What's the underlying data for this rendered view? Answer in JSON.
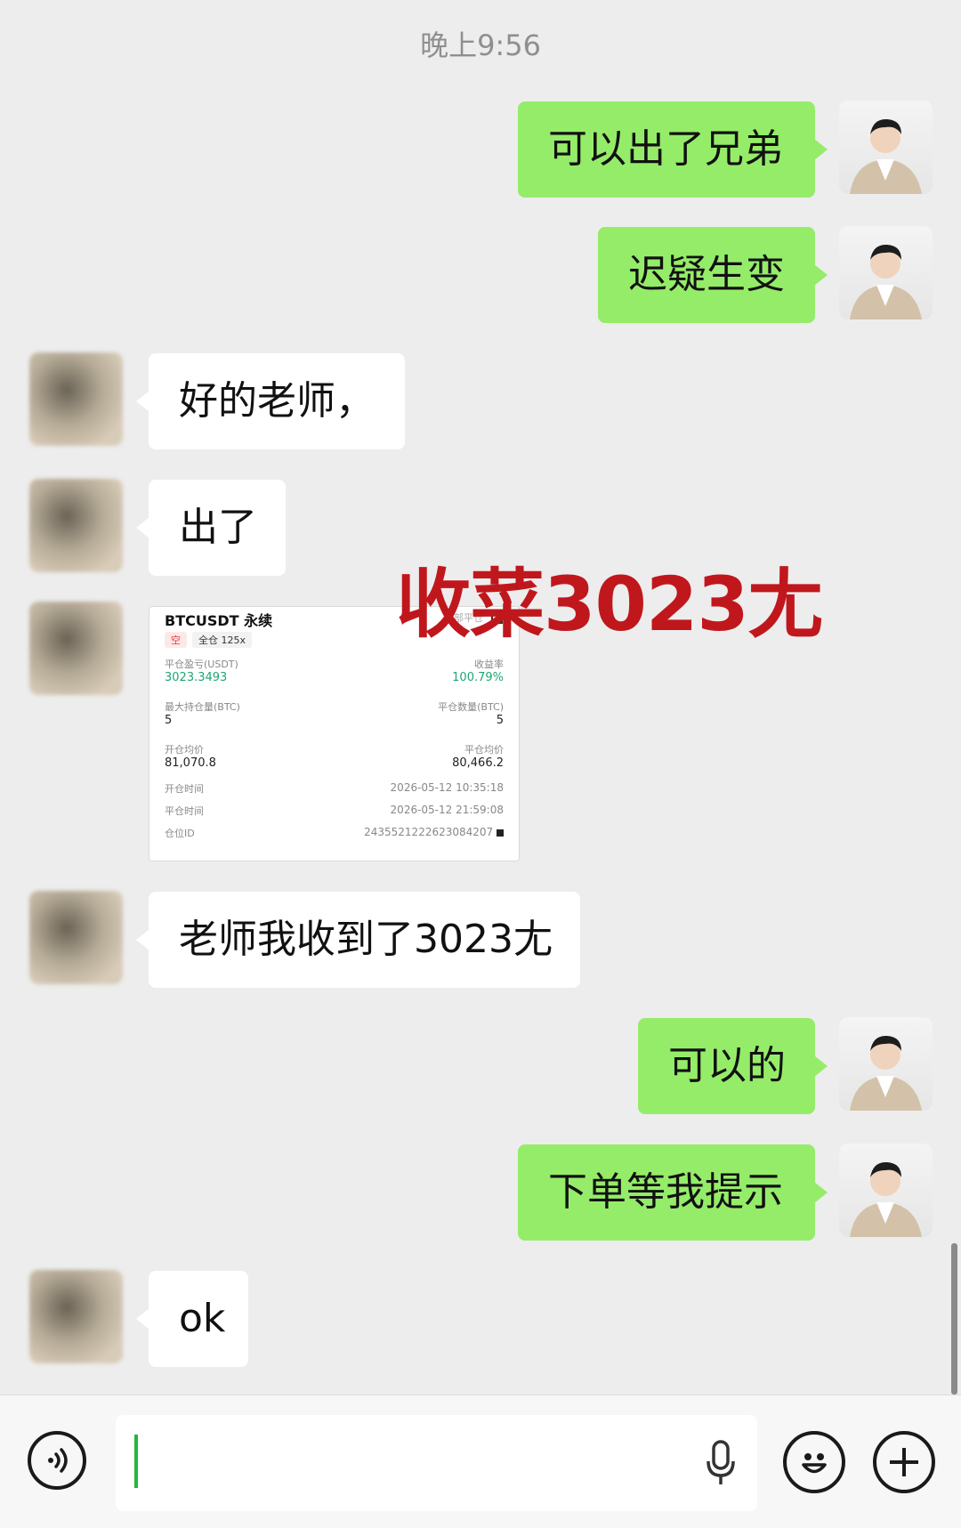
{
  "status": {
    "time": "晚上9:56"
  },
  "messages": {
    "m1": "可以出了兄弟",
    "m2": "迟疑生变",
    "m3": "好的老师，",
    "m4": "出了",
    "m6": "老师我收到了3023尢",
    "m7": "可以的",
    "m8": "下单等我提示",
    "m9": "ok"
  },
  "overlay_text": "收菜3023尢",
  "trade_card": {
    "title": "BTCUSDT 永续",
    "tag_side": "空",
    "tag_margin": "全仓 125x",
    "header_right": "全部平仓",
    "pnl_label": "平仓盈亏(USDT)",
    "pnl_value": "3023.3493",
    "roi_label": "收益率",
    "roi_value": "100.79%",
    "max_pos_label": "最大持仓量(BTC)",
    "max_pos_value": "5",
    "close_qty_label": "平仓数量(BTC)",
    "close_qty_value": "5",
    "open_avg_label": "开仓均价",
    "open_avg_value": "81,070.8",
    "close_avg_label": "平仓均价",
    "close_avg_value": "80,466.2",
    "open_time_label": "开仓时间",
    "open_time_value": "2026-05-12 10:35:18",
    "close_time_label": "平仓时间",
    "close_time_value": "2026-05-12 21:59:08",
    "pos_id_label": "仓位ID",
    "pos_id_value": "2435521222623084207"
  },
  "icons": {
    "voice": "voice-input-icon",
    "mic": "microphone-icon",
    "emoji": "emoji-icon",
    "plus": "plus-icon"
  },
  "colors": {
    "my_bubble": "#95ec69",
    "their_bubble": "#ffffff",
    "background": "#ededed",
    "overlay": "#c0171d",
    "caret": "#20b93a"
  }
}
